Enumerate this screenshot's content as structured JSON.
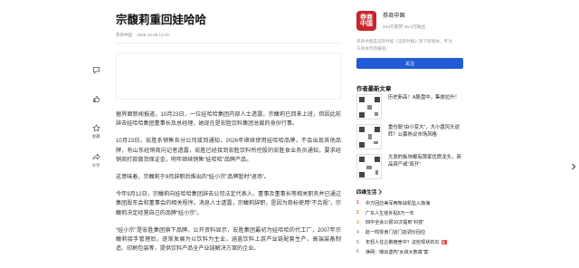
{
  "article": {
    "title": "宗馥莉重回娃哈哈",
    "source": "券商中国",
    "datetime": "2025-10-25 13:19",
    "paragraphs": [
      "据界面新闻报道，10月23日，一位娃哈哈集团内部人士透露，宗馥莉已回来上班，但因此前辞去娃哈哈集团董事长及总经理，她现在是宏胜饮料集团总裁的身份行事。",
      "10月23日，宏胜系销售各分公司接到通知，2026年继续使用娃哈哈品牌，不会出现其他品牌，有山东经销商向记者透露，宏胜已经接到宏胜饮料所控股的宏胜食业务员通知，要求经销商打款做货保证金，明年继续销售“娃哈哈”品牌产品。",
      "这意味着，宗馥莉于9月辞职后推出的“娃小宗”品牌暂时“退场”。",
      "今年9月12日，宗馥莉向娃哈哈集团辞去公司法定代表人、董事及董事长等相关职务并已通过集团股东会和董事会的相关程序。消息人士透露，宗馥莉辞职，是因为商标使用“不合规”，宗馥莉决定经营自己的品牌“娃小宗”。",
      "“娃小宗”是宏胜集团旗下品牌。公开资料显示，宏胜集团最初为娃哈哈的代工厂，2007年宗馥莉接手管理后，逐渐发展为以饮料为主业，涵盖饮料上游产业链配套生产、高端装备制造、印刷包装等，提供饮料产品全产业链解决方案的企业。"
    ]
  },
  "share_rail": {
    "comment_label": "",
    "like_label": "",
    "favorite_label": "收藏",
    "share_label": "分享"
  },
  "author_card": {
    "logo_text": "券商\n中国",
    "name": "券商中国",
    "stats": "244万获赞 46.5万粉丝",
    "description": "券商中国是证券时报《证券时报》旗下新媒体，专注于资本市场报道。",
    "follow_label": "关注"
  },
  "more_articles": {
    "heading": "作者最新文章",
    "items": [
      {
        "title": "历史新高！A股盘中，集体拉升！"
      },
      {
        "title": "重仓股“由小变大”，大小盘风头逆转？公募热议市场风格"
      },
      {
        "title": "大涨的板块都有那家优质龙头，商品资产或“双开”"
      }
    ]
  },
  "hot_list": {
    "heading": "四维生活",
    "items": [
      {
        "rank": "1",
        "text": "中方回应美军两架战机坠入南海",
        "badge": ""
      },
      {
        "rank": "2",
        "text": "广东人生娃补贴5万一年",
        "badge": ""
      },
      {
        "rank": "3",
        "text": "四中全会公报10次提到“科技”",
        "badge": ""
      },
      {
        "rank": "4",
        "text": "赵一鸣零食门店门店调价回应",
        "badge": ""
      },
      {
        "rank": "5",
        "text": "年轻人住企鹅宿舍中？这些现状的瓜",
        "badge": "新"
      },
      {
        "rank": "6",
        "text": "净网：曝出虚构“女孩大熊真”案",
        "badge": ""
      }
    ]
  },
  "colors": {
    "accent": "#1f5bd6",
    "brand_red": "#c9252c",
    "rank1": "#e4393c",
    "rank2": "#f06b29",
    "rank3": "#f3a024"
  }
}
